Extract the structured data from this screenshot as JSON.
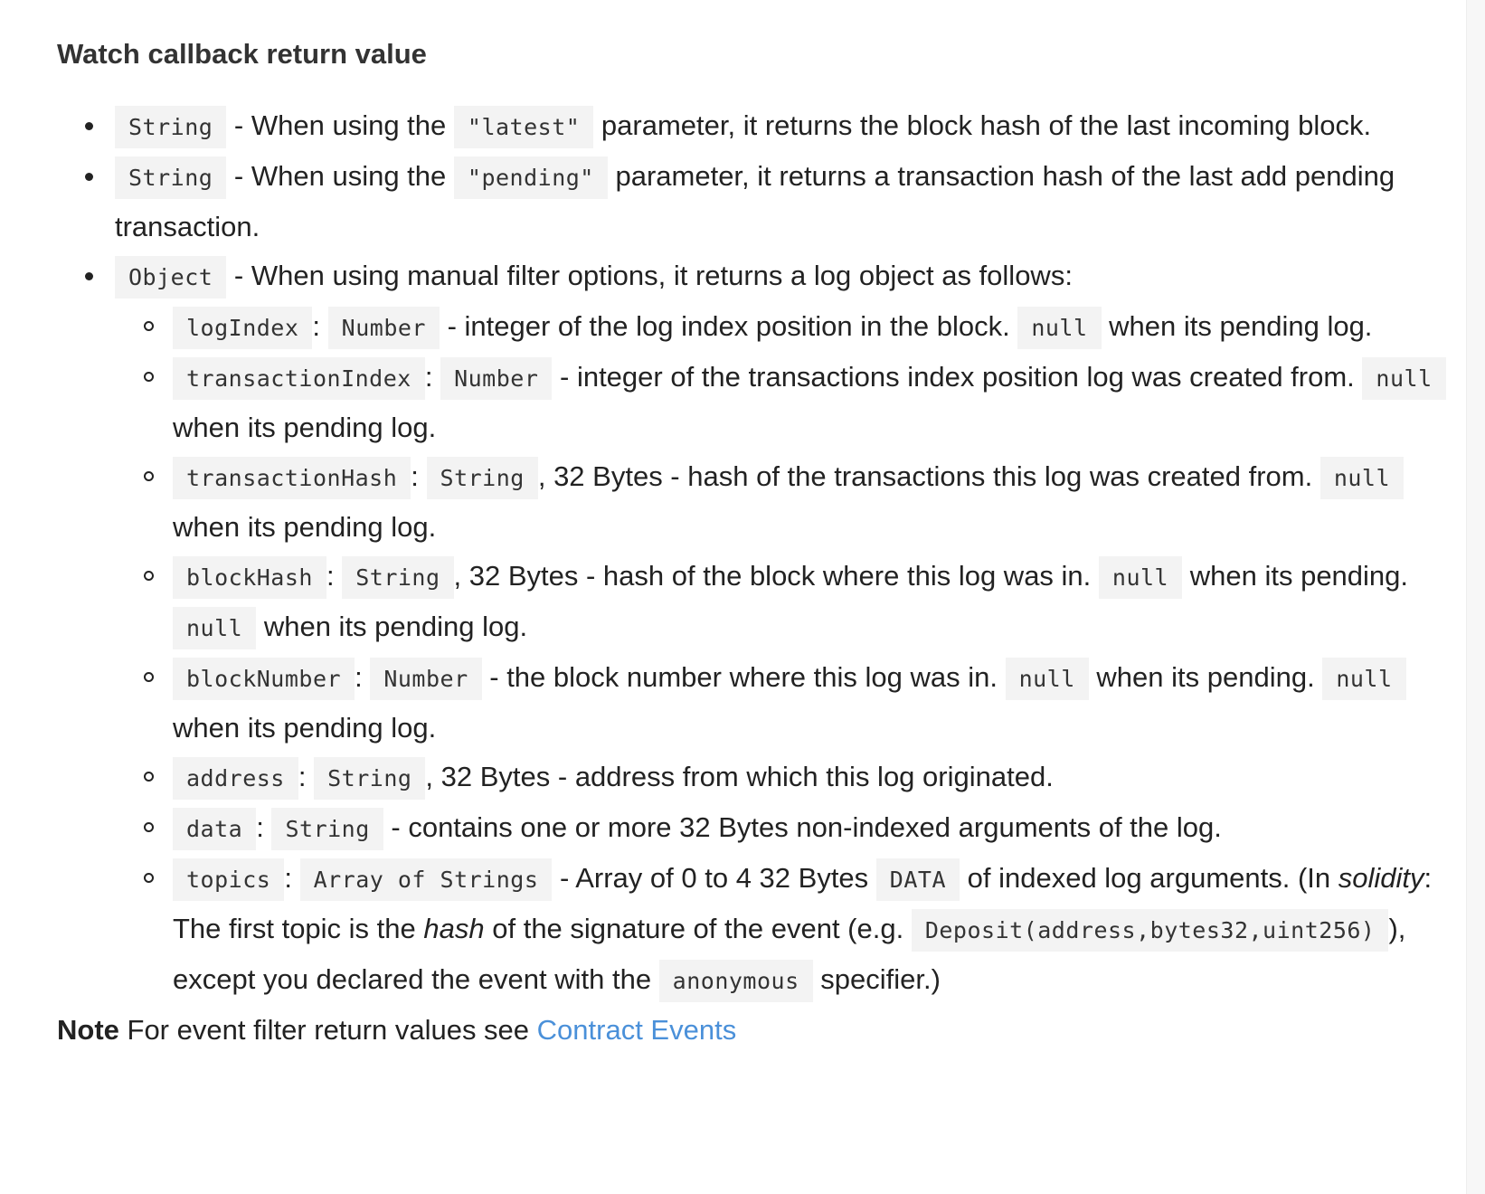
{
  "heading": "Watch callback return value",
  "items": [
    {
      "type": "String",
      "t1": " - When using the ",
      "param": "\"latest\"",
      "t2": " parameter, it returns the block hash of the last incoming block."
    },
    {
      "type": "String",
      "t1": " - When using the ",
      "param": "\"pending\"",
      "t2": " parameter, it returns a transaction hash of the last add pending transaction."
    },
    {
      "type": "Object",
      "t1": " - When using manual filter options, it returns a log object as follows:"
    }
  ],
  "colon": ":",
  "null_code": "null",
  "fields": {
    "logIndex": {
      "name": "logIndex",
      "type": "Number",
      "t1": " - integer of the log index position in the block. ",
      "t2": " when its pending log."
    },
    "transactionIndex": {
      "name": "transactionIndex",
      "type": "Number",
      "t1": " - integer of the transactions index position log was created from. ",
      "t2": " when its pending log."
    },
    "transactionHash": {
      "name": "transactionHash",
      "type": "String",
      "t1": ", 32 Bytes - hash of the transactions this log was created from. ",
      "t2": " when its pending log."
    },
    "blockHash": {
      "name": "blockHash",
      "type": "String",
      "t1": ", 32 Bytes - hash of the block where this log was in. ",
      "t2": " when its pending. ",
      "t3": " when its pending log."
    },
    "blockNumber": {
      "name": "blockNumber",
      "type": "Number",
      "t1": " - the block number where this log was in. ",
      "t2": " when its pending. ",
      "t3": " when its pending log."
    },
    "address": {
      "name": "address",
      "type": "String",
      "t1": ", 32 Bytes - address from which this log originated."
    },
    "data": {
      "name": "data",
      "type": "String",
      "t1": " - contains one or more 32 Bytes non-indexed arguments of the log."
    },
    "topics": {
      "name": "topics",
      "type": "Array of Strings",
      "t1": " - Array of 0 to 4 32 Bytes ",
      "data_code": "DATA",
      "t2": " of indexed log arguments. (In ",
      "em1": "solidity",
      "t3": ": The first topic is the ",
      "em2": "hash",
      "t4": " of the signature of the event (e.g. ",
      "example_code": "Deposit(address,bytes32,uint256)",
      "t5": "), except you declared the event with the ",
      "anon_code": "anonymous",
      "t6": " specifier.)"
    }
  },
  "note": {
    "label": "Note",
    "text": " For event filter return values see ",
    "link": "Contract Events"
  }
}
